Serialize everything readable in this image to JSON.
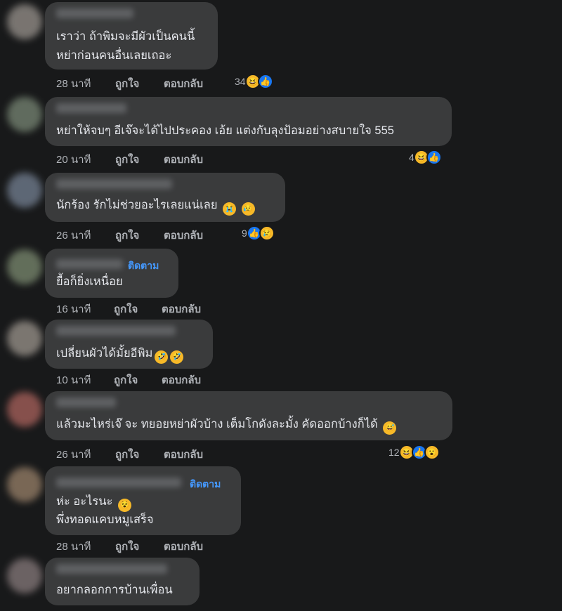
{
  "labels": {
    "like": "ถูกใจ",
    "reply": "ตอบกลับ",
    "follow": "ติดตาม"
  },
  "colors": {
    "background": "#18191a",
    "bubble": "#3a3b3c",
    "follow": "#4599ff",
    "haha": "#f7b928",
    "like": "#1877f2"
  },
  "comments": [
    {
      "line1": "เราว่า ถ้าพิมจะมีผัวเป็นคนนี้",
      "line2": "หย่าก่อนคนอื่นเลยเถอะ",
      "time": "28 นาที",
      "reaction_count": "34",
      "reactions": [
        "haha-icon",
        "like-icon"
      ]
    },
    {
      "line1": "หย่าให้จบๆ อีเจ๊จะได้ไปประคอง เอ้ย แต่งกับลุงป้อมอย่างสบายใจ 555",
      "time": "20 นาที",
      "reaction_count": "4",
      "reactions": [
        "haha-icon",
        "like-icon"
      ]
    },
    {
      "line1": "นักร้อง รักไม่ช่วยอะไรเลยแน่เลย",
      "inline_emojis": [
        "crying-icon",
        "sad-face-icon"
      ],
      "time": "26 นาที",
      "reaction_count": "9",
      "reactions": [
        "like-icon",
        "sad-icon"
      ]
    },
    {
      "line1": "ยื้อก็ยิ่งเหนื่อย",
      "time": "16 นาที",
      "follow": true
    },
    {
      "line1": "เปลี่ยนผัวได้มั้ยอีพิม",
      "inline_emojis": [
        "rofl-icon",
        "rofl-icon"
      ],
      "time": "10 นาที"
    },
    {
      "line1": "แล้วมะไหร่เจ๊ จะ ทยอยหย่าผัวบ้าง เต็มโกดังละมั้ง คัดออกบ้างก็ได้",
      "inline_emojis": [
        "sweat-smile-icon"
      ],
      "time": "26 นาที",
      "reaction_count": "12",
      "reactions": [
        "haha-icon",
        "like-icon",
        "wow-icon"
      ]
    },
    {
      "line1": "ห่ะ อะไรนะ",
      "line2": "พึ่งทอดแคบหมูเสร็จ",
      "inline_emojis": [
        "dizzy-face-icon"
      ],
      "time": "28 นาที",
      "follow": true
    },
    {
      "line1": "อยากลอกการบ้านเพื่อน"
    }
  ]
}
